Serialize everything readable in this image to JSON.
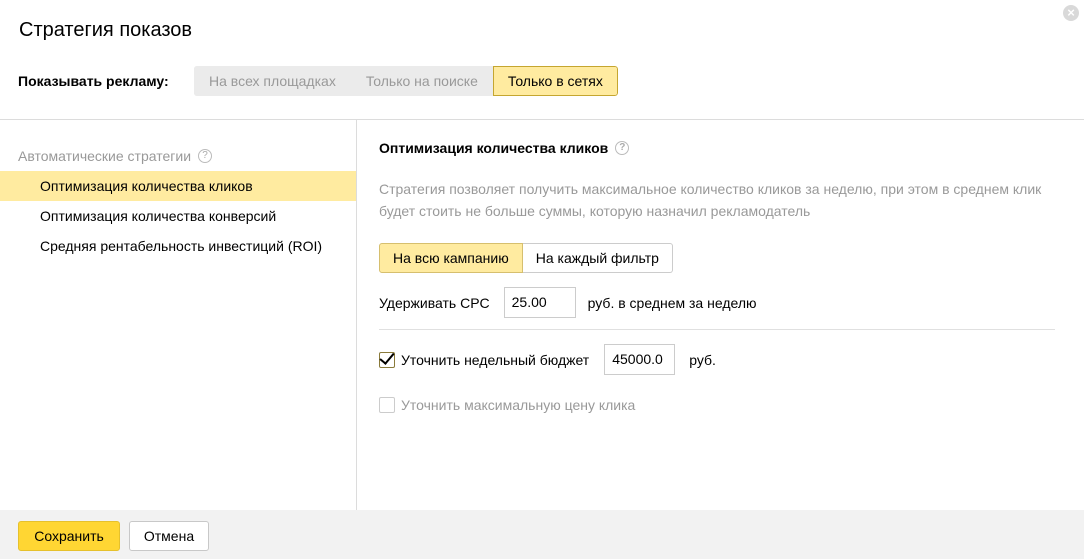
{
  "dialog": {
    "title": "Стратегия показов",
    "close_icon": "×"
  },
  "show_ads": {
    "label": "Показывать рекламу:",
    "options": [
      "На всех площадках",
      "Только на поиске",
      "Только в сетях"
    ],
    "selected": "Только в сетях"
  },
  "sidebar": {
    "header": "Автоматические стратегии",
    "help_icon": "?",
    "items": [
      {
        "label": "Оптимизация количества кликов",
        "active": true
      },
      {
        "label": "Оптимизация количества конверсий",
        "active": false
      },
      {
        "label": "Средняя рентабельность инвестиций (ROI)",
        "active": false
      }
    ]
  },
  "main": {
    "title": "Оптимизация количества кликов",
    "help_icon": "?",
    "description": "Стратегия позволяет получить максимальное количество кликов за неделю, при этом в среднем клик будет стоить не больше суммы, которую назначил рекламодатель",
    "scope": {
      "options": [
        "На всю кампанию",
        "На каждый фильтр"
      ],
      "selected": "На всю кампанию"
    },
    "cpc": {
      "label": "Удерживать CPC",
      "value": "25.00",
      "suffix": "руб. в среднем за неделю"
    },
    "weekly_budget": {
      "checked": true,
      "label": "Уточнить недельный бюджет",
      "value": "45000.0",
      "suffix": "руб."
    },
    "max_click_price": {
      "checked": false,
      "label": "Уточнить максимальную цену клика"
    }
  },
  "footer": {
    "save_label": "Сохранить",
    "cancel_label": "Отмена"
  },
  "colors": {
    "accent_selected": "#ffeba0",
    "save_button": "#ffd633",
    "muted_text": "#999999",
    "footer_bg": "#f2f2f2"
  }
}
